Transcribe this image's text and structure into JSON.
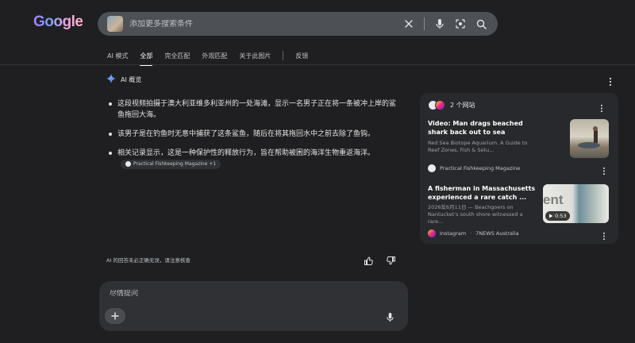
{
  "header": {
    "logo_text": "Google",
    "search_placeholder": "添加更多搜索条件"
  },
  "tabs": [
    {
      "label": "AI 模式"
    },
    {
      "label": "全部"
    },
    {
      "label": "完全匹配"
    },
    {
      "label": "外观匹配"
    },
    {
      "label": "关于此图片"
    },
    {
      "label": "反馈"
    }
  ],
  "ai_overview": {
    "title": "AI 概览",
    "bullets": [
      "这段视频拍摄于澳大利亚维多利亚州的一处海滩，显示一名男子正在将一条被冲上岸的鲨鱼拖回大海。",
      "该男子是在钓鱼时无意中捕获了这条鲨鱼，随后在将其拖回水中之前去除了鱼钩。",
      "相关记录显示，这是一种保护性的释放行为，旨在帮助被困的海洋生物重返海洋。"
    ],
    "chip_label": "Practical Fishkeeping Magazine +1",
    "disclaimer": "AI 的回答未必正确无误，请注意核查"
  },
  "ask": {
    "placeholder": "尽情提问"
  },
  "sources_panel": {
    "count_label": "2 个网站",
    "cards": [
      {
        "title": "Video: Man drags beached shark back out to sea",
        "desc": "Red Sea Biotope Aquarium. A Guide to Reef Zones, Fish & Setu...",
        "source": "Practical Fishkeeping Magazine"
      },
      {
        "title": "A fisherman in Massachusetts experienced a rare catch ...",
        "desc": "2026年6月11日 — Beachgoers on Nantucket's south shore witnessed a rare...",
        "source": "Instagram",
        "source2": "7NEWS Australia",
        "duration": "0:53",
        "thumb_text": "ent"
      }
    ]
  }
}
